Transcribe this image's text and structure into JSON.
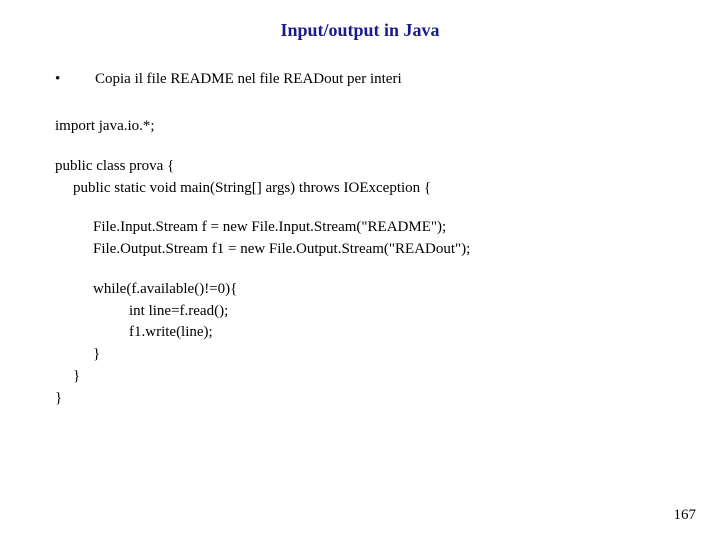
{
  "title": "Input/output in Java",
  "bullet": {
    "marker": "•",
    "text": "Copia il file README nel file READout per interi"
  },
  "code": {
    "l0": "import java.io.*;",
    "l1": "public class prova {",
    "l2": "public static void main(String[] args) throws IOException {",
    "l3": "File.Input.Stream f = new File.Input.Stream(\"README\");",
    "l4": "File.Output.Stream f1 = new File.Output.Stream(\"READout\");",
    "l5": "while(f.available()!=0){",
    "l6": "int line=f.read();",
    "l7": "f1.write(line);",
    "l8": "}",
    "l9": "}",
    "l10": "}"
  },
  "page_number": "167"
}
